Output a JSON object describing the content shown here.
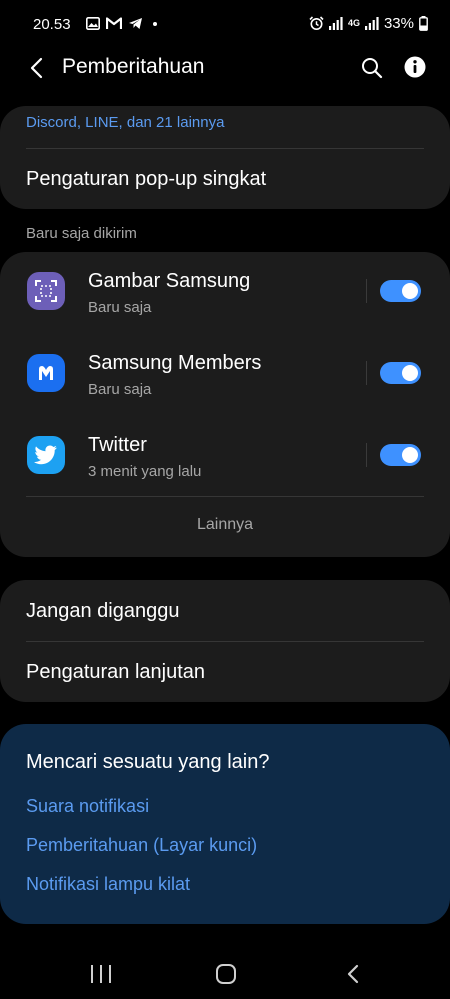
{
  "status_bar": {
    "time": "20.53",
    "network_label": "4G",
    "battery_percent": "33%"
  },
  "app_bar": {
    "title": "Pemberitahuan"
  },
  "top_card": {
    "subtitle": "Discord, LINE, dan 21 lainnya",
    "popup_label": "Pengaturan pop-up singkat"
  },
  "recent": {
    "header": "Baru saja dikirim",
    "apps": [
      {
        "name": "Gambar Samsung",
        "time": "Baru saja",
        "enabled": true,
        "icon": "samsung-capture-icon",
        "color": "#6d5fb8"
      },
      {
        "name": "Samsung Members",
        "time": "Baru saja",
        "enabled": true,
        "icon": "samsung-members-icon",
        "color": "#1b6ff0"
      },
      {
        "name": "Twitter",
        "time": "3 menit yang lalu",
        "enabled": true,
        "icon": "twitter-bird-icon",
        "color": "#1da1f2"
      }
    ],
    "more_label": "Lainnya"
  },
  "settings": {
    "dnd_label": "Jangan diganggu",
    "advanced_label": "Pengaturan lanjutan"
  },
  "suggest": {
    "title": "Mencari sesuatu yang lain?",
    "links": [
      "Suara notifikasi",
      "Pemberitahuan (Layar kunci)",
      "Notifikasi lampu kilat"
    ]
  },
  "colors": {
    "accent": "#3e91ff",
    "link": "#5b9bf0",
    "card": "#1c1c1c",
    "suggest_card": "#0e2a47"
  }
}
